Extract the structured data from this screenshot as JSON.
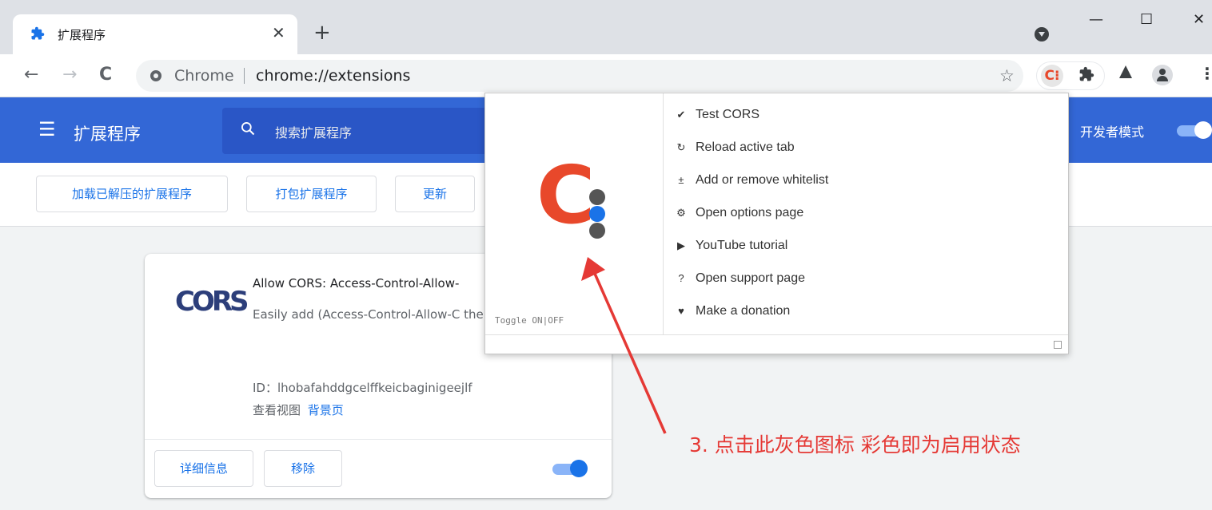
{
  "tab": {
    "title": "扩展程序",
    "close": "✕",
    "new_tab": "+"
  },
  "window_controls": {
    "minimize": "—",
    "maximize": "☐",
    "close": "✕"
  },
  "toolbar": {
    "back": "←",
    "forward": "→",
    "reload": "C",
    "site_name": "Chrome",
    "url": "chrome://extensions",
    "star": "☆",
    "ext_cors_glyph": "C⁝",
    "menu": "⋮"
  },
  "header": {
    "title": "扩展程序",
    "search_placeholder": "搜索扩展程序",
    "dev_mode_label": "开发者模式",
    "dev_mode_on": true
  },
  "subbar": {
    "load_unpacked": "加载已解压的扩展程序",
    "pack": "打包扩展程序",
    "update": "更新"
  },
  "card": {
    "logo_text": "CORS",
    "name": "Allow CORS: Access-Control-Allow-",
    "description": "Easily add (Access-Control-Allow-C the response header.",
    "id": "ID：lhobafahddgcelffkeicbaginigeejlf",
    "views_label": "查看视图",
    "views_link": "背景页",
    "details_button": "详细信息",
    "remove_button": "移除",
    "enabled": true
  },
  "popup": {
    "toggle_text": "Toggle ON|OFF",
    "items": [
      {
        "icon": "✔",
        "label": "Test CORS"
      },
      {
        "icon": "↻",
        "label": "Reload active tab"
      },
      {
        "icon": "±",
        "label": "Add or remove whitelist"
      },
      {
        "icon": "⚙",
        "label": "Open options page"
      },
      {
        "icon": "▶",
        "label": "YouTube tutorial"
      },
      {
        "icon": "?",
        "label": "Open support page"
      },
      {
        "icon": "♥",
        "label": "Make a donation"
      }
    ],
    "logo_letter": "C",
    "dot_colors": [
      "#555555",
      "#1a73e8",
      "#555555"
    ]
  },
  "annotation": {
    "text": "3. 点击此灰色图标 彩色即为启用状态",
    "color": "#e53935"
  },
  "colors": {
    "header_blue": "#3367d6",
    "accent": "#1a73e8",
    "cors_orange": "#e8482b"
  }
}
